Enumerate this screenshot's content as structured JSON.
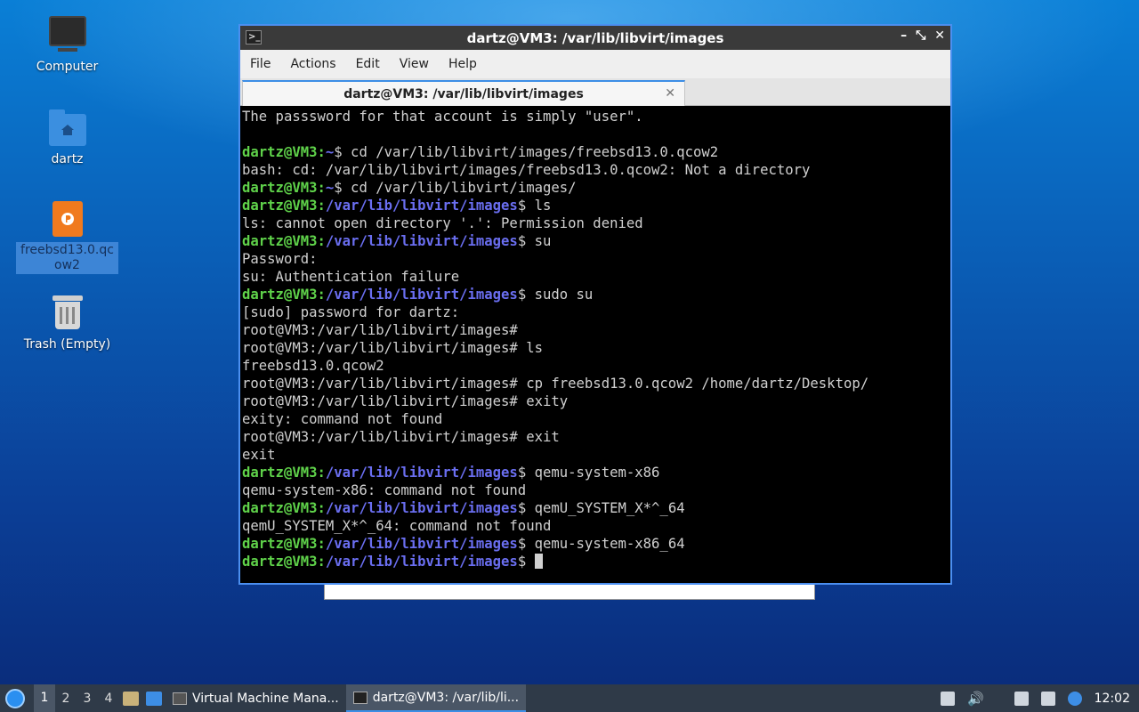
{
  "desktop": {
    "icons": [
      {
        "label": "Computer"
      },
      {
        "label": "dartz"
      },
      {
        "label": "freebsd13.0.qcow2"
      },
      {
        "label": "Trash (Empty)"
      }
    ]
  },
  "window": {
    "title": "dartz@VM3: /var/lib/libvirt/images",
    "menu": [
      "File",
      "Actions",
      "Edit",
      "View",
      "Help"
    ],
    "tab_label": "dartz@VM3: /var/lib/libvirt/images",
    "buttons": {
      "minimize": "–",
      "maximize": "⤡",
      "close": "✕"
    },
    "tab_close": "✕"
  },
  "terminal": {
    "prompt_user": "dartz@VM3",
    "lines": [
      {
        "t": "plain",
        "text": "The passsword for that account is simply \"user\"."
      },
      {
        "t": "plain",
        "text": ""
      },
      {
        "t": "prompt",
        "path": "~",
        "cmd": "cd /var/lib/libvirt/images/freebsd13.0.qcow2"
      },
      {
        "t": "plain",
        "text": "bash: cd: /var/lib/libvirt/images/freebsd13.0.qcow2: Not a directory"
      },
      {
        "t": "prompt",
        "path": "~",
        "cmd": "cd /var/lib/libvirt/images/"
      },
      {
        "t": "prompt",
        "path": "/var/lib/libvirt/images",
        "cmd": "ls"
      },
      {
        "t": "plain",
        "text": "ls: cannot open directory '.': Permission denied"
      },
      {
        "t": "prompt",
        "path": "/var/lib/libvirt/images",
        "cmd": "su"
      },
      {
        "t": "plain",
        "text": "Password:"
      },
      {
        "t": "plain",
        "text": "su: Authentication failure"
      },
      {
        "t": "prompt",
        "path": "/var/lib/libvirt/images",
        "cmd": "sudo su"
      },
      {
        "t": "plain",
        "text": "[sudo] password for dartz:"
      },
      {
        "t": "plain",
        "text": "root@VM3:/var/lib/libvirt/images#"
      },
      {
        "t": "plain",
        "text": "root@VM3:/var/lib/libvirt/images# ls"
      },
      {
        "t": "plain",
        "text": "freebsd13.0.qcow2"
      },
      {
        "t": "plain",
        "text": "root@VM3:/var/lib/libvirt/images# cp freebsd13.0.qcow2 /home/dartz/Desktop/"
      },
      {
        "t": "plain",
        "text": "root@VM3:/var/lib/libvirt/images# exity"
      },
      {
        "t": "plain",
        "text": "exity: command not found"
      },
      {
        "t": "plain",
        "text": "root@VM3:/var/lib/libvirt/images# exit"
      },
      {
        "t": "plain",
        "text": "exit"
      },
      {
        "t": "prompt",
        "path": "/var/lib/libvirt/images",
        "cmd": "qemu-system-x86"
      },
      {
        "t": "plain",
        "text": "qemu-system-x86: command not found"
      },
      {
        "t": "prompt",
        "path": "/var/lib/libvirt/images",
        "cmd": "qemU_SYSTEM_X*^_64"
      },
      {
        "t": "plain",
        "text": "qemU_SYSTEM_X*^_64: command not found"
      },
      {
        "t": "prompt",
        "path": "/var/lib/libvirt/images",
        "cmd": "qemu-system-x86_64"
      },
      {
        "t": "prompt",
        "path": "/var/lib/libvirt/images",
        "cmd": "",
        "cursor": true
      }
    ]
  },
  "taskbar": {
    "workspaces": [
      "1",
      "2",
      "3",
      "4"
    ],
    "tasks": [
      {
        "label": "Virtual Machine Mana...",
        "active": false
      },
      {
        "label": "dartz@VM3: /var/lib/li...",
        "active": true
      }
    ],
    "clock": "12:02"
  }
}
